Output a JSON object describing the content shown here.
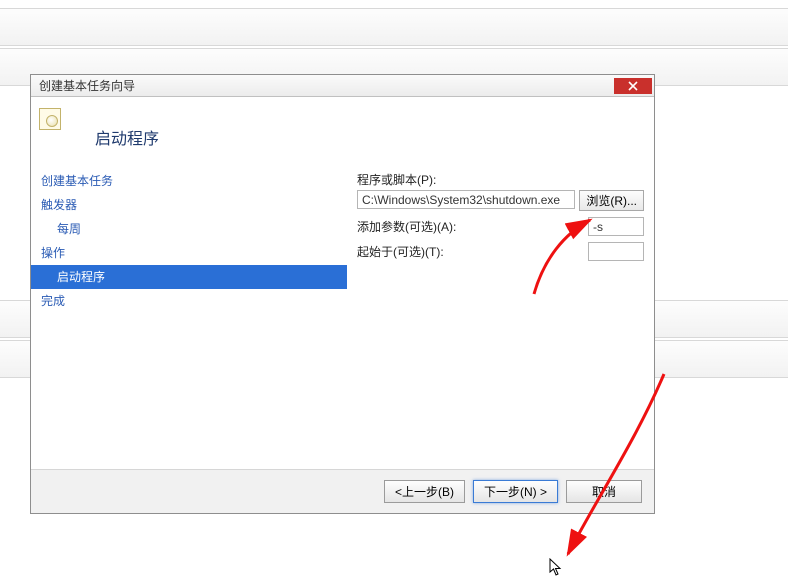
{
  "dialog": {
    "title": "创建基本任务向导",
    "page_title": "启动程序"
  },
  "sidebar": {
    "items": [
      {
        "label": "创建基本任务",
        "kind": "parent"
      },
      {
        "label": "触发器",
        "kind": "parent"
      },
      {
        "label": "每周",
        "kind": "child"
      },
      {
        "label": "操作",
        "kind": "parent"
      },
      {
        "label": "启动程序",
        "kind": "child",
        "selected": true
      },
      {
        "label": "完成",
        "kind": "parent"
      }
    ]
  },
  "form": {
    "program_label": "程序或脚本(P):",
    "program_value": "C:\\Windows\\System32\\shutdown.exe",
    "browse_label": "浏览(R)...",
    "args_label": "添加参数(可选)(A):",
    "args_value": "-s",
    "startin_label": "起始于(可选)(T):",
    "startin_value": ""
  },
  "footer": {
    "back": "<上一步(B)",
    "next": "下一步(N) >",
    "cancel": "取消"
  }
}
